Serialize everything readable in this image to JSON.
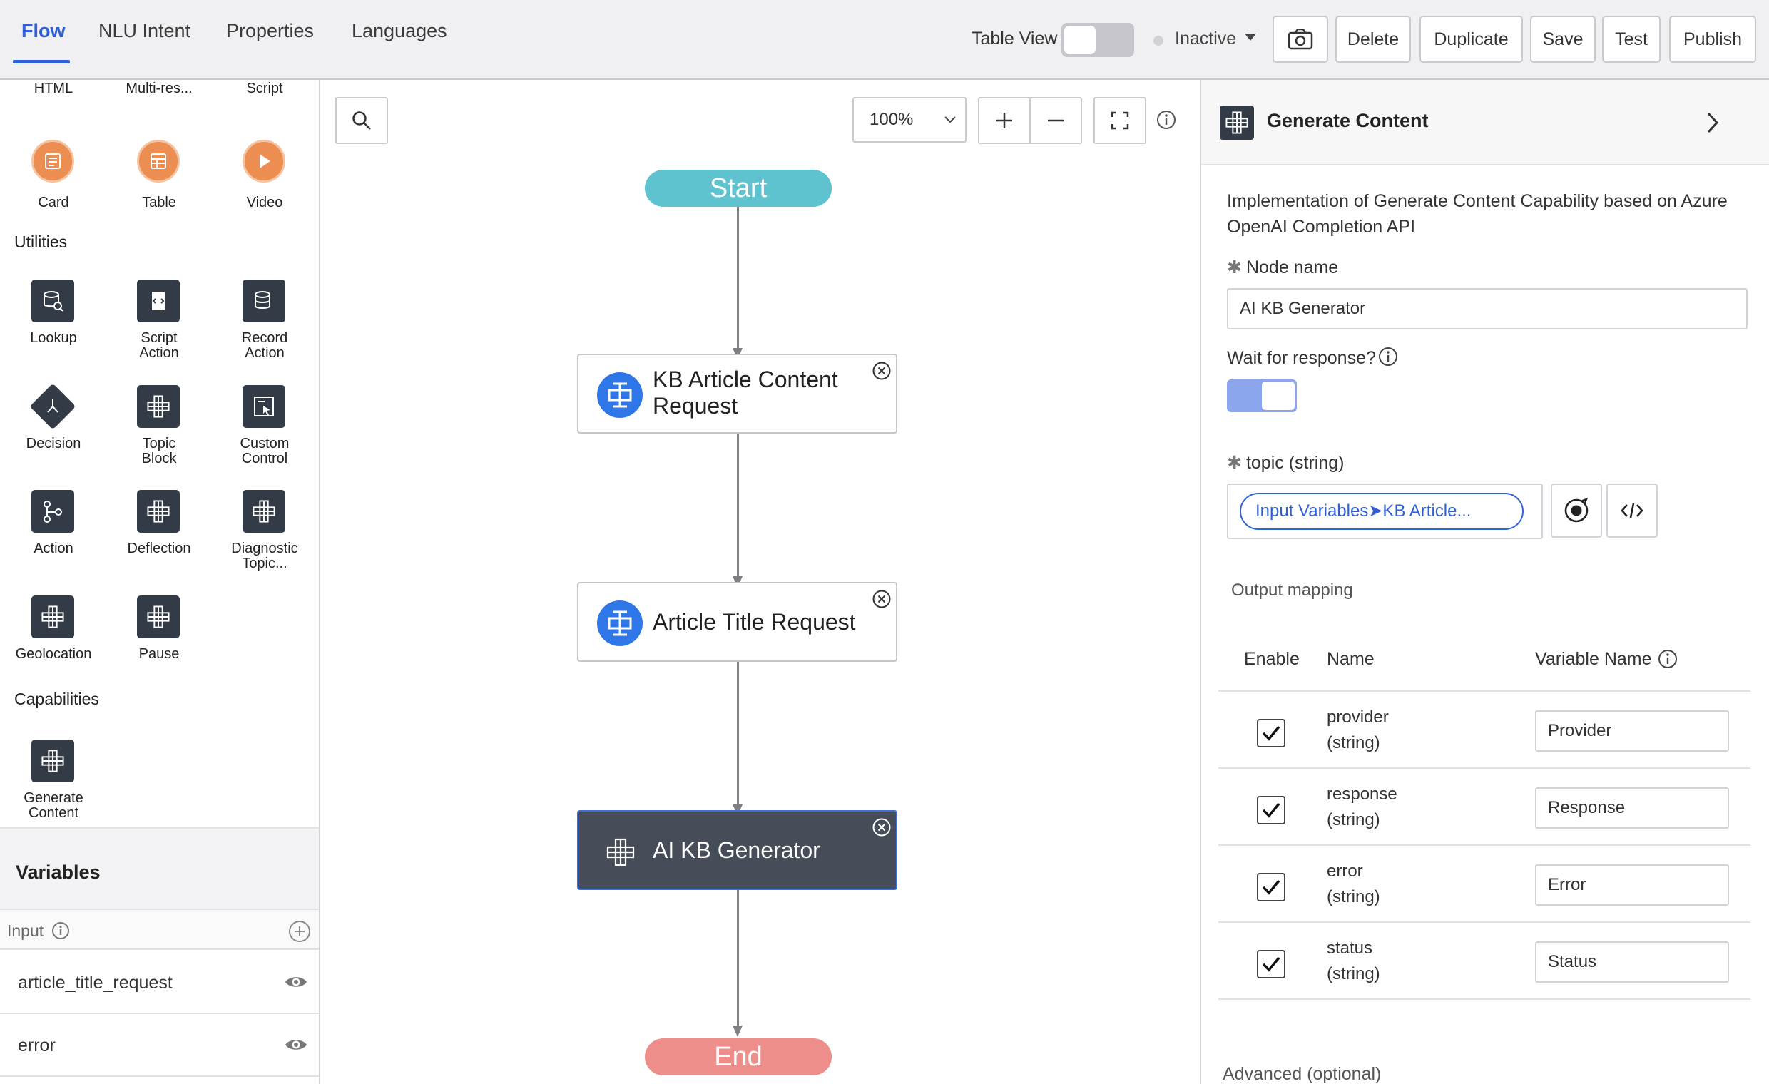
{
  "topbar": {
    "tabs": [
      {
        "label": "Flow",
        "active": true
      },
      {
        "label": "NLU Intent",
        "active": false
      },
      {
        "label": "Properties",
        "active": false
      },
      {
        "label": "Languages",
        "active": false
      }
    ],
    "table_view_label": "Table View",
    "table_view_on": false,
    "status_label": "Inactive",
    "buttons": {
      "screenshot_icon": "camera-icon",
      "delete": "Delete",
      "duplicate": "Duplicate",
      "save": "Save",
      "test": "Test",
      "publish": "Publish"
    }
  },
  "palette": {
    "top_row": [
      "HTML",
      "Multi-res...",
      "Script"
    ],
    "media": [
      {
        "label": "Card",
        "icon": "card-icon"
      },
      {
        "label": "Table",
        "icon": "table-icon"
      },
      {
        "label": "Video",
        "icon": "play-icon"
      }
    ],
    "utilities_title": "Utilities",
    "utilities": [
      {
        "label": "Lookup",
        "icon": "lookup-icon"
      },
      {
        "label": "Script\nAction",
        "icon": "script-action-icon"
      },
      {
        "label": "Record\nAction",
        "icon": "record-action-icon"
      },
      {
        "label": "Decision",
        "icon": "decision-icon"
      },
      {
        "label": "Topic\nBlock",
        "icon": "topic-block-icon"
      },
      {
        "label": "Custom\nControl",
        "icon": "custom-control-icon"
      },
      {
        "label": "Action",
        "icon": "action-icon"
      },
      {
        "label": "Deflection",
        "icon": "deflection-icon"
      },
      {
        "label": "Diagnostic\nTopic...",
        "icon": "diagnostic-topic-icon"
      },
      {
        "label": "Geolocation",
        "icon": "geolocation-icon"
      },
      {
        "label": "Pause",
        "icon": "pause-icon"
      }
    ],
    "capabilities_title": "Capabilities",
    "capabilities": [
      {
        "label": "Generate\nContent",
        "icon": "generate-content-icon"
      }
    ]
  },
  "variables": {
    "title": "Variables",
    "input_label": "Input",
    "items": [
      {
        "name": "article_title_request"
      },
      {
        "name": "error"
      }
    ]
  },
  "canvas": {
    "zoom": "100%",
    "start_label": "Start",
    "end_label": "End",
    "nodes": [
      {
        "title": "KB Article Content Request",
        "line1": "KB Article Content",
        "line2": "Request",
        "selected": false
      },
      {
        "title": "Article Title Request",
        "selected": false
      },
      {
        "title": "AI KB Generator",
        "selected": true
      }
    ]
  },
  "properties": {
    "title": "Generate Content",
    "description": "Implementation of Generate Content Capability based on Azure OpenAI Completion API",
    "node_name_label": "Node name",
    "node_name_value": "AI KB Generator",
    "wait_label": "Wait for response?",
    "wait_on": true,
    "topic_label": "topic  (string)",
    "topic_chip": "Input Variables➤KB Article...",
    "output_mapping_label": "Output mapping",
    "columns": [
      "Enable",
      "Name",
      "Variable Name"
    ],
    "outputs": [
      {
        "name": "provider",
        "type": "(string)",
        "variable": "Provider",
        "enabled": true
      },
      {
        "name": "response",
        "type": "(string)",
        "variable": "Response",
        "enabled": true
      },
      {
        "name": "error",
        "type": "(string)",
        "variable": "Error",
        "enabled": true
      },
      {
        "name": "status",
        "type": "(string)",
        "variable": "Status",
        "enabled": true
      }
    ],
    "advanced_label": "Advanced (optional)"
  }
}
